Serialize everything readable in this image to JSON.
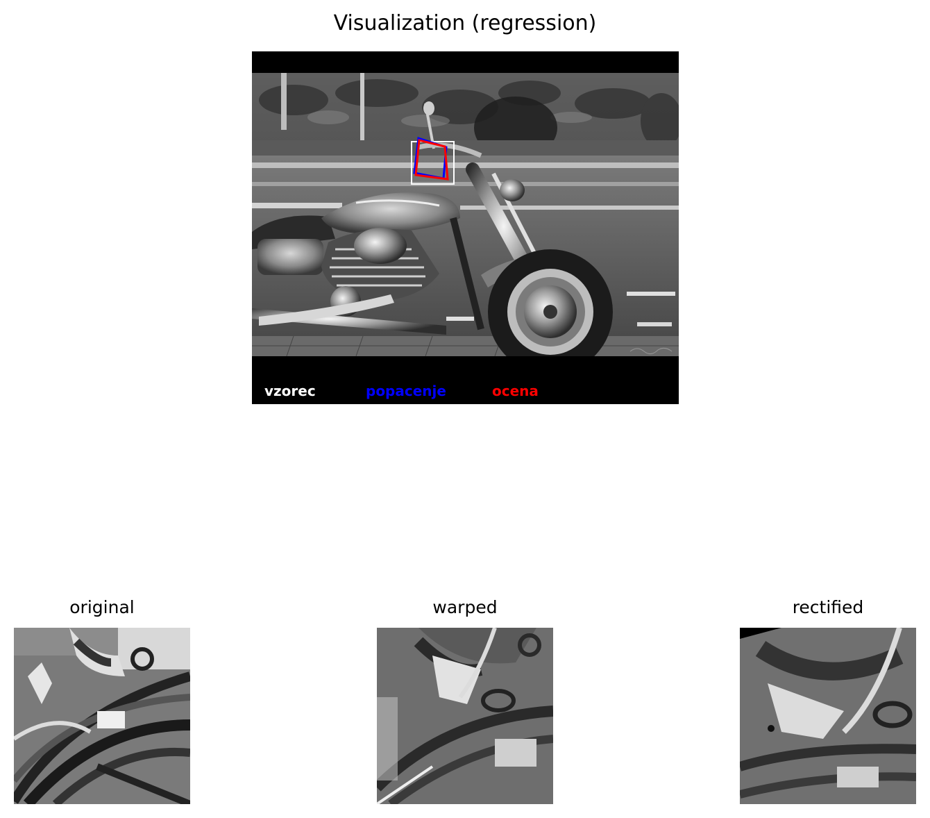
{
  "figure": {
    "title": "Visualization (regression)"
  },
  "main_image": {
    "legend": {
      "sample_label": "vzorec",
      "sample_color": "#ffffff",
      "distortion_label": "popacenje",
      "distortion_color": "#0000ff",
      "estimate_label": "ocena",
      "estimate_color": "#ff0000"
    }
  },
  "subplots": [
    {
      "title": "original"
    },
    {
      "title": "warped"
    },
    {
      "title": "rectified"
    }
  ]
}
